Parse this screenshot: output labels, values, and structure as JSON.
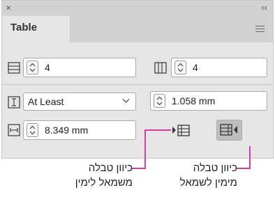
{
  "panel": {
    "close_glyph": "×",
    "collapse_glyph": "‹‹",
    "tab_label": "Table",
    "menu_icon": "hamburger-menu-icon"
  },
  "rows": {
    "body_rows_value": "4",
    "columns_value": "4",
    "row_height_mode": "At Least",
    "row_height_value": "1.058 mm",
    "column_width_value": "8.349 mm"
  },
  "icons": {
    "rows": "table-rows-icon",
    "columns": "table-columns-icon",
    "row_height": "row-height-icon",
    "column_width": "column-width-icon",
    "stepper": "up-down-stepper-icon",
    "dropdown": "chevron-down-icon",
    "ltr": "table-direction-left-to-right-icon",
    "rtl": "table-direction-right-to-left-icon"
  },
  "annotations": {
    "rtl_line1": "כיוון טבלה",
    "rtl_line2": "מימין לשמאל",
    "ltr_line1": "כיוון טבלה",
    "ltr_line2": "משמאל לימין"
  },
  "colors": {
    "leader_line": "#d63ca0",
    "active_button": "#bdbdbd"
  }
}
